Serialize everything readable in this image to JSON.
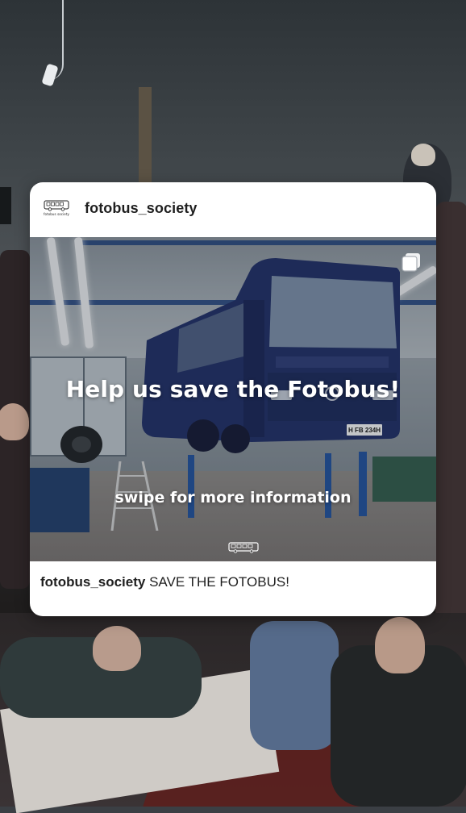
{
  "post": {
    "username": "fotobus_society",
    "avatar_text": "fotobus society",
    "headline": "Help us save the Fotobus!",
    "subline": "swipe for more information",
    "caption_user": "fotobus_society",
    "caption_text": "SAVE THE FOTOBUS!",
    "license_plate": "H FB 234H"
  },
  "icons": {
    "avatar": "bus-logo-icon",
    "multi_image": "carousel-icon",
    "watermark": "mini-bus-icon"
  },
  "colors": {
    "card_bg": "#ffffff",
    "bus_blue": "#1b2a66",
    "text": "#1f1f1f"
  }
}
